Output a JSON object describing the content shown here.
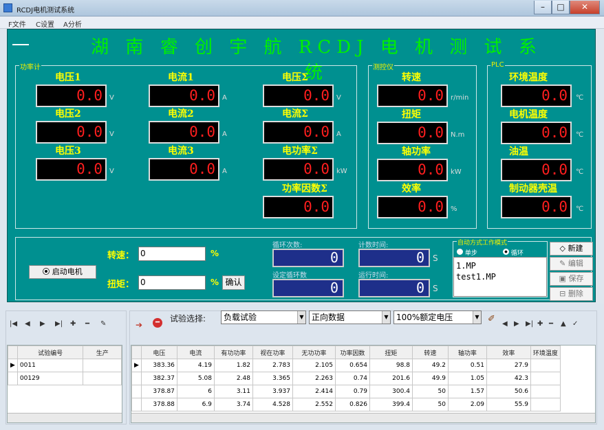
{
  "window": {
    "title": "RCDJ电机测试系统",
    "min": "–",
    "max": "□",
    "close": "✕"
  },
  "menu": [
    "F文件",
    "C设置",
    "A分析"
  ],
  "system_title": "湖 南 睿 创 宇 航 RCDJ 电 机 测 试 系 统",
  "groups": {
    "power": "功率计",
    "torque": "测控仪",
    "plc": "PLC"
  },
  "power_meters": [
    {
      "label": "电压1",
      "value": "0.0",
      "unit": "V"
    },
    {
      "label": "电流1",
      "value": "0.0",
      "unit": "A"
    },
    {
      "label": "电压Σ",
      "value": "0.0",
      "unit": "V"
    },
    {
      "label": "电压2",
      "value": "0.0",
      "unit": "V"
    },
    {
      "label": "电流2",
      "value": "0.0",
      "unit": "A"
    },
    {
      "label": "电流Σ",
      "value": "0.0",
      "unit": "A"
    },
    {
      "label": "电压3",
      "value": "0.0",
      "unit": "V"
    },
    {
      "label": "电流3",
      "value": "0.0",
      "unit": "A"
    },
    {
      "label": "电功率Σ",
      "value": "0.0",
      "unit": "kW"
    },
    {
      "label": "功率因数Σ",
      "value": "0.0",
      "unit": ""
    }
  ],
  "torque_meters": [
    {
      "label": "转速",
      "value": "0.0",
      "unit": "r/min"
    },
    {
      "label": "扭矩",
      "value": "0.0",
      "unit": "N.m"
    },
    {
      "label": "轴功率",
      "value": "0.0",
      "unit": "kW"
    },
    {
      "label": "效率",
      "value": "0.0",
      "unit": "%"
    }
  ],
  "plc_meters": [
    {
      "label": "环境温度",
      "value": "0.0",
      "unit": "℃"
    },
    {
      "label": "电机温度",
      "value": "0.0",
      "unit": "℃"
    },
    {
      "label": "油温",
      "value": "0.0",
      "unit": "℃"
    },
    {
      "label": "制动器壳温",
      "value": "0.0",
      "unit": "℃"
    }
  ],
  "control": {
    "start_label": "启动电机",
    "speed_label": "转速：",
    "speed_value": "0",
    "speed_unit": "%",
    "torque_label": "扭矩：",
    "torque_value": "0",
    "torque_unit": "%",
    "confirm_label": "确认",
    "counters": [
      {
        "label": "循环次数:",
        "value": "0",
        "unit": ""
      },
      {
        "label": "计数时间:",
        "value": "0",
        "unit": "S"
      },
      {
        "label": "设定循环数",
        "value": "0",
        "unit": ""
      },
      {
        "label": "运行时间:",
        "value": "0",
        "unit": "S"
      }
    ],
    "mode_title": "自动方式工作模式",
    "mode_options": [
      "单步",
      "循环"
    ],
    "files": [
      "1.MP",
      "test1.MP"
    ],
    "side_buttons": [
      "新建",
      "编辑",
      "保存",
      "删除"
    ]
  },
  "toolbar_left": [
    "|◀",
    "◀",
    "▶",
    "▶|",
    "✚",
    "━",
    "✎"
  ],
  "test_select": {
    "label": "试验选择:",
    "options": [
      "负载试验",
      "正向数据",
      "100%额定电压"
    ]
  },
  "toolbar_right": [
    "◀",
    "▶",
    "▶|",
    "✚",
    "━",
    "▲",
    "✓"
  ],
  "left_table": {
    "headers": [
      "试验编号",
      "生产"
    ],
    "rows": [
      [
        "0011",
        ""
      ],
      [
        "00129",
        ""
      ]
    ]
  },
  "right_table": {
    "headers": [
      "电压",
      "电流",
      "有功功率",
      "视在功率",
      "无功功率",
      "功率因数",
      "扭矩",
      "转速",
      "轴功率",
      "效率",
      "环境温度"
    ],
    "rows": [
      [
        "383.36",
        "4.19",
        "1.82",
        "2.783",
        "2.105",
        "0.654",
        "98.8",
        "49.2",
        "0.51",
        "27.9",
        ""
      ],
      [
        "382.37",
        "5.08",
        "2.48",
        "3.365",
        "2.263",
        "0.74",
        "201.6",
        "49.9",
        "1.05",
        "42.3",
        ""
      ],
      [
        "378.87",
        "6",
        "3.11",
        "3.937",
        "2.414",
        "0.79",
        "300.4",
        "50",
        "1.57",
        "50.6",
        ""
      ],
      [
        "378.88",
        "6.9",
        "3.74",
        "4.528",
        "2.552",
        "0.826",
        "399.4",
        "50",
        "2.09",
        "55.9",
        ""
      ]
    ]
  },
  "colors": {
    "panel": "#009090",
    "title_green": "#00f000",
    "label_yellow": "#ffff00",
    "digit_red": "#ff1e1e",
    "counter_bg": "#1e2f8a"
  }
}
